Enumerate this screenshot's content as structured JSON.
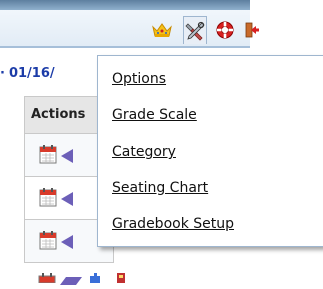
{
  "toolbar": {
    "icons": [
      "crown-icon",
      "tools-icon",
      "lifebuoy-icon",
      "exit-icon"
    ],
    "active": "tools-icon"
  },
  "date_partial": "01/16/",
  "grid": {
    "header": "Actions"
  },
  "menu": {
    "items": [
      {
        "label": "Options"
      },
      {
        "label": "Grade Scale"
      },
      {
        "label": "Category"
      },
      {
        "label": "Seating Chart"
      },
      {
        "label": "Gradebook Setup"
      }
    ]
  },
  "colors": {
    "link": "#1c3ca8",
    "border": "#9fb6cf",
    "topbar": "#e2ecf6"
  }
}
